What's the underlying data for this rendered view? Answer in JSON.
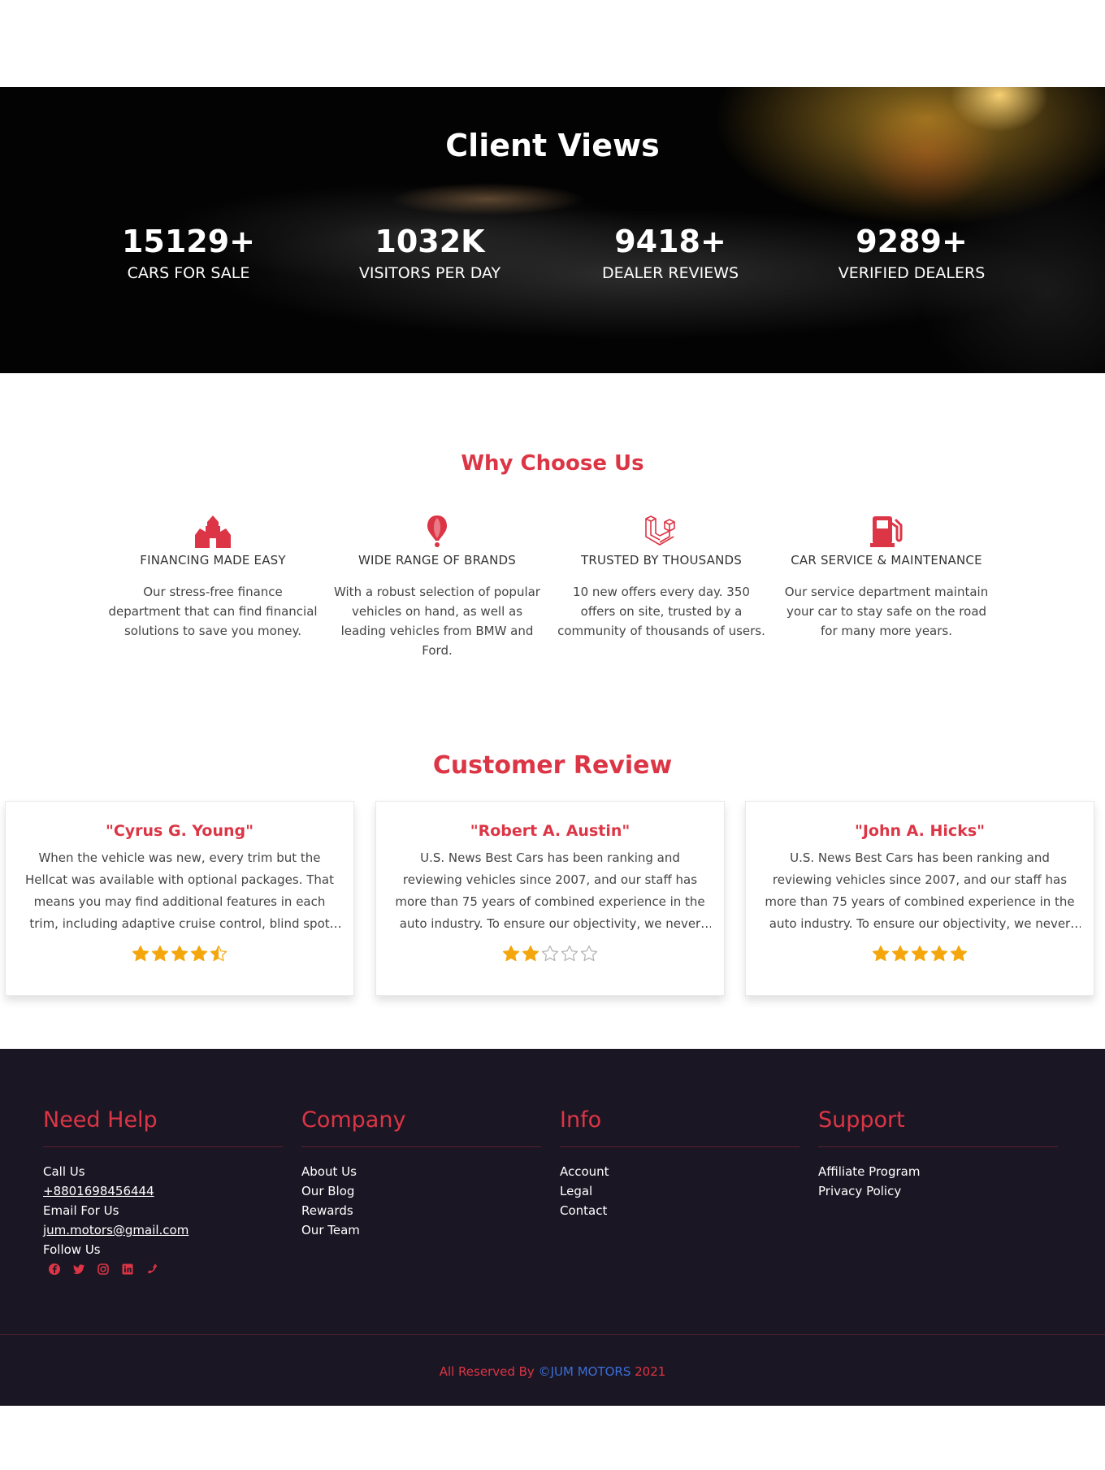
{
  "client_views": {
    "title": "Client Views",
    "stats": [
      {
        "number": "15129+",
        "label": "CARS FOR SALE"
      },
      {
        "number": "1032K",
        "label": "VISITORS PER DAY"
      },
      {
        "number": "9418+",
        "label": "DEALER REVIEWS"
      },
      {
        "number": "9289+",
        "label": "VERIFIED DEALERS"
      }
    ]
  },
  "why_choose_us": {
    "title": "Why Choose Us",
    "features": [
      {
        "icon": "bank-icon",
        "title": "FINANCING MADE EASY",
        "text": "Our stress-free finance department that can find financial solutions to save you money."
      },
      {
        "icon": "map-pin-icon",
        "title": "WIDE RANGE OF BRANDS",
        "text": "With a robust selection of popular vehicles on hand, as well as leading vehicles from BMW and Ford."
      },
      {
        "icon": "laravel-icon",
        "title": "TRUSTED BY THOUSANDS",
        "text": "10 new offers every day. 350 offers on site, trusted by a community of thousands of users."
      },
      {
        "icon": "gas-pump-icon",
        "title": "CAR SERVICE & MAINTENANCE",
        "text": "Our service department maintain your car to stay safe on the road for many more years."
      }
    ]
  },
  "customer_review": {
    "title": "Customer Review",
    "reviews": [
      {
        "name": "\"Cyrus G. Young\"",
        "text": "When the vehicle was new, every trim but the Hellcat was available with optional packages. That means you may find additional features in each trim, including adaptive cruise control, blind spot monitoring, rear cross traffic alerts.",
        "rating": 4.5
      },
      {
        "name": "\"Robert A. Austin\"",
        "text": "U.S. News Best Cars has been ranking and reviewing vehicles since 2007, and our staff has more than 75 years of combined experience in the auto industry. To ensure our objectivity, we never accept expensive gifts from automakers.",
        "rating": 2
      },
      {
        "name": "\"John A. Hicks\"",
        "text": "U.S. News Best Cars has been ranking and reviewing vehicles since 2007, and our staff has more than 75 years of combined experience in the auto industry. To ensure our objectivity, we never accept expensive gifts from automakers.",
        "rating": 5
      }
    ],
    "colors": {
      "star": "#f4a60c",
      "star_empty": "#b0b0b0"
    }
  },
  "footer": {
    "need_help": {
      "heading": "Need Help",
      "call_label": "Call Us",
      "phone": "+8801698456444",
      "email_label": "Email For Us",
      "email": "jum.motors@gmail.com",
      "follow_label": "Follow Us",
      "social_icons": [
        "facebook-icon",
        "twitter-icon",
        "instagram-icon",
        "linkedin-icon",
        "phone-icon"
      ]
    },
    "company": {
      "heading": "Company",
      "links": [
        "About Us",
        "Our Blog",
        "Rewards",
        "Our Team"
      ]
    },
    "info": {
      "heading": "Info",
      "links": [
        "Account",
        "Legal",
        "Contact"
      ]
    },
    "support": {
      "heading": "Support",
      "links": [
        "Affiliate Program",
        "Privacy Policy"
      ]
    },
    "copyright": {
      "prefix": "All Reserved By ",
      "brand": "©JUM MOTORS",
      "suffix": " 2021"
    }
  },
  "colors": {
    "accent": "#dc3545",
    "footer_bg": "#1b1624",
    "brand_link": "#3b6fd8"
  }
}
